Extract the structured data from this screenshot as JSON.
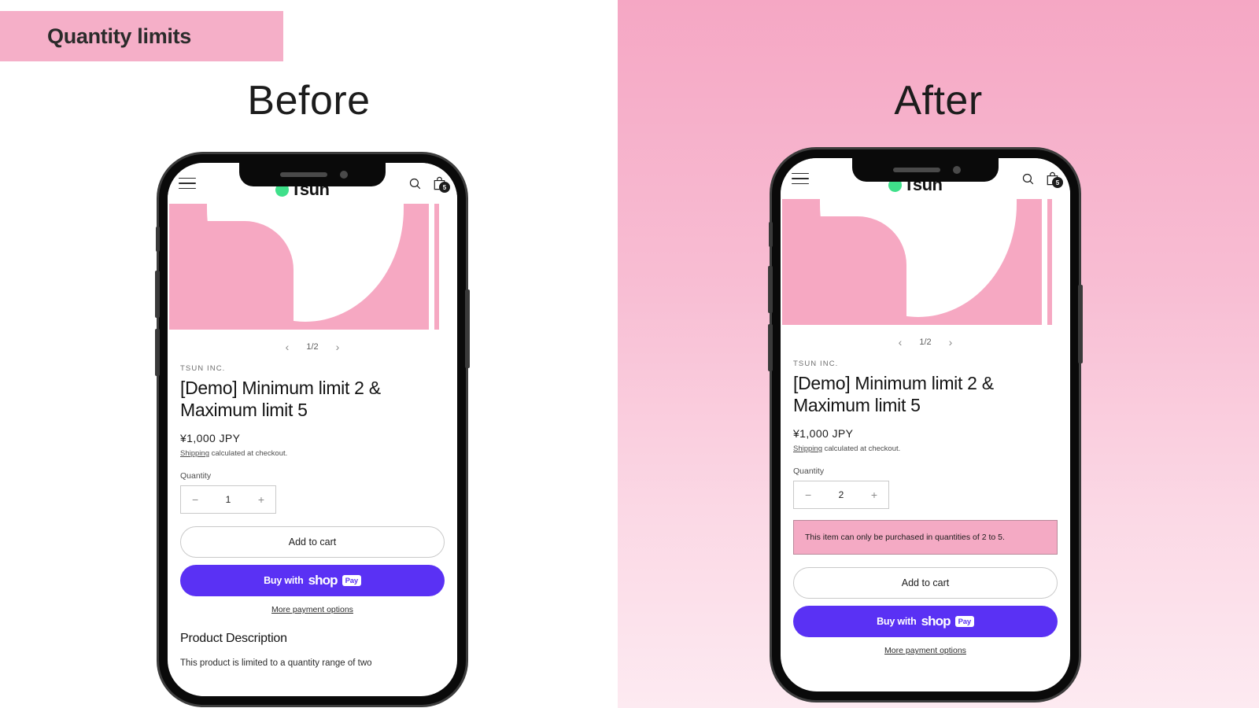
{
  "banner": {
    "title": "Quantity limits",
    "bg_color": "#f5afc8"
  },
  "panels": {
    "before": {
      "label": "Before"
    },
    "after": {
      "label": "After"
    }
  },
  "store_header": {
    "menu_icon": "hamburger-icon",
    "logo_text": "Tsun",
    "logo_mark": "leaf-icon",
    "search_icon": "search-icon",
    "cart_icon": "shopping-bag-icon",
    "cart_count": "5"
  },
  "carousel": {
    "prev": "‹",
    "counter": "1/2",
    "next": "›"
  },
  "product": {
    "vendor": "TSUN INC.",
    "title": "[Demo] Minimum limit 2 & Maximum limit 5",
    "price": "¥1,000 JPY",
    "shipping_link": "Shipping",
    "shipping_rest": " calculated at checkout.",
    "quantity_label": "Quantity",
    "qty_minus": "−",
    "qty_plus": "+",
    "qty_before": "1",
    "qty_after": "2",
    "add_to_cart": "Add to cart",
    "buy_prefix": "Buy with",
    "buy_brand": "shop",
    "buy_pay": "Pay",
    "more_payment": "More payment options",
    "description_heading": "Product Description",
    "description_body": "This product is limited to a quantity range of two"
  },
  "warning": {
    "message": "This item can only be purchased in quantities of 2 to 5.",
    "bg_color": "#f4aac4",
    "border_color": "#b9889a"
  },
  "colors": {
    "shop_pay_purple": "#5a31f4",
    "product_pink": "#f6a8c2",
    "logo_green": "#3fe08a"
  }
}
